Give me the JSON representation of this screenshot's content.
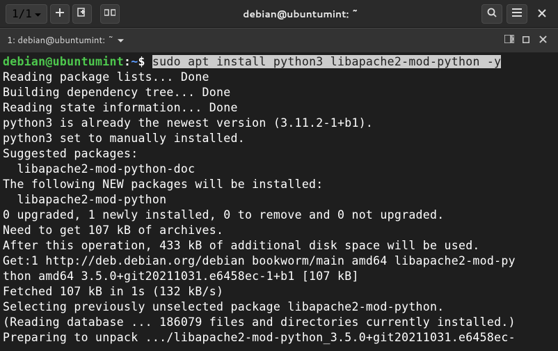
{
  "titlebar": {
    "tab_counter": "1/1",
    "title": "debian@ubuntumint: ~"
  },
  "tabbar": {
    "tab_label": "1: debian@ubuntumint: ~"
  },
  "terminal": {
    "prompt": {
      "user": "debian",
      "at": "@",
      "host": "ubuntumint",
      "colon": ":",
      "path": "~",
      "dollar": "$"
    },
    "command": "sudo apt install python3 libapache2-mod-python -y",
    "lines": [
      "Reading package lists... Done",
      "Building dependency tree... Done",
      "Reading state information... Done",
      "python3 is already the newest version (3.11.2-1+b1).",
      "python3 set to manually installed.",
      "Suggested packages:",
      "  libapache2-mod-python-doc",
      "The following NEW packages will be installed:",
      "  libapache2-mod-python",
      "0 upgraded, 1 newly installed, 0 to remove and 0 not upgraded.",
      "Need to get 107 kB of archives.",
      "After this operation, 433 kB of additional disk space will be used.",
      "Get:1 http://deb.debian.org/debian bookworm/main amd64 libapache2-mod-py",
      "thon amd64 3.5.0+git20211031.e6458ec-1+b1 [107 kB]",
      "Fetched 107 kB in 1s (132 kB/s)",
      "Selecting previously unselected package libapache2-mod-python.",
      "(Reading database ... 186079 files and directories currently installed.)",
      "Preparing to unpack .../libapache2-mod-python_3.5.0+git20211031.e6458ec-"
    ]
  }
}
